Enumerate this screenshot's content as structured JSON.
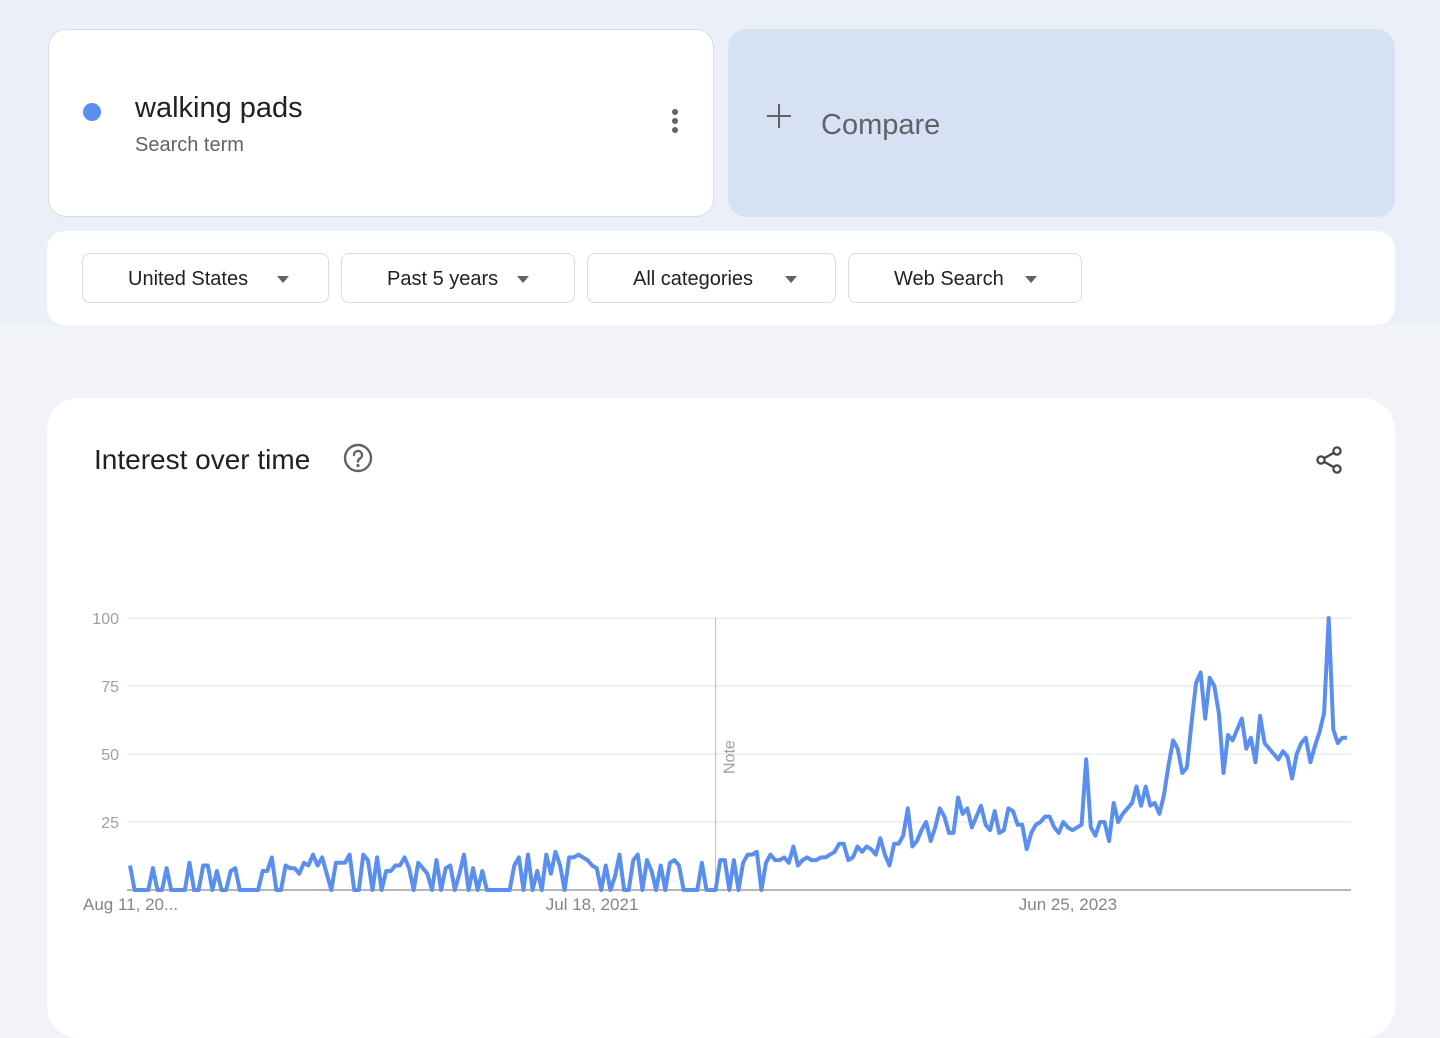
{
  "term": {
    "name": "walking pads",
    "type": "Search term",
    "color": "#5a8ff0",
    "more_icon": "more-vert-icon"
  },
  "compare": {
    "label": "Compare",
    "icon": "plus-icon"
  },
  "filters": [
    {
      "label": "United States"
    },
    {
      "label": "Past 5 years"
    },
    {
      "label": "All categories"
    },
    {
      "label": "Web Search"
    }
  ],
  "chart": {
    "title": "Interest over time",
    "help_icon": "help-circle-icon",
    "share_icon": "share-icon"
  },
  "chart_data": {
    "type": "line",
    "series": [
      {
        "name": "walking pads",
        "color": "#5a8ff0",
        "values": [
          9,
          0,
          0,
          0,
          0,
          8,
          0,
          0,
          8,
          0,
          0,
          0,
          0,
          10,
          0,
          0,
          9,
          9,
          0,
          7,
          0,
          0,
          7,
          8,
          0,
          0,
          0,
          0,
          0,
          7,
          7,
          12,
          0,
          0,
          9,
          8,
          8,
          6,
          10,
          9,
          13,
          9,
          12,
          6,
          0,
          10,
          10,
          10,
          13,
          0,
          0,
          13,
          11,
          0,
          12,
          0,
          7,
          7,
          9,
          9,
          12,
          8,
          0,
          10,
          8,
          6,
          0,
          11,
          0,
          8,
          9,
          0,
          6,
          13,
          0,
          8,
          0,
          7,
          0,
          0,
          0,
          0,
          0,
          0,
          9,
          12,
          0,
          13,
          0,
          7,
          0,
          13,
          6,
          14,
          9,
          0,
          12,
          12,
          13,
          12,
          11,
          9,
          8,
          0,
          9,
          0,
          5,
          13,
          0,
          0,
          11,
          13,
          0,
          11,
          7,
          0,
          9,
          0,
          10,
          11,
          9,
          0,
          0,
          0,
          0,
          10,
          0,
          0,
          0,
          11,
          11,
          0,
          11,
          0,
          10,
          13,
          13,
          14,
          0,
          10,
          13,
          11,
          11,
          12,
          10,
          16,
          9,
          11,
          12,
          11,
          11,
          12,
          12,
          13,
          14,
          17,
          17,
          11,
          12,
          16,
          14,
          16,
          15,
          13,
          19,
          13,
          9,
          17,
          17,
          20,
          30,
          16,
          18,
          22,
          25,
          18,
          23,
          30,
          27,
          21,
          21,
          34,
          28,
          30,
          23,
          27,
          31,
          24,
          22,
          29,
          21,
          22,
          30,
          29,
          24,
          24,
          15,
          21,
          24,
          25,
          27,
          27,
          23,
          21,
          25,
          23,
          22,
          23,
          24,
          48,
          23,
          20,
          25,
          25,
          18,
          32,
          25,
          28,
          30,
          32,
          38,
          31,
          38,
          31,
          32,
          28,
          35,
          46,
          55,
          52,
          43,
          45,
          61,
          76,
          80,
          63,
          78,
          75,
          65,
          43,
          57,
          55,
          59,
          63,
          52,
          56,
          47,
          64,
          54,
          52,
          50,
          48,
          51,
          49,
          41,
          50,
          54,
          56,
          47,
          53,
          58,
          65,
          100,
          59,
          54,
          56,
          56
        ],
        "x_labels": [
          {
            "label": "Aug 11, 20...",
            "index": 0
          },
          {
            "label": "Jul 18, 2021",
            "index": 101
          },
          {
            "label": "Jun 25, 2023",
            "index": 205
          }
        ]
      }
    ],
    "yticks": [
      25,
      50,
      75,
      100
    ],
    "ylim": [
      0,
      100
    ],
    "grid": true,
    "annotations": [
      {
        "label": "Note",
        "index": 128
      }
    ]
  }
}
